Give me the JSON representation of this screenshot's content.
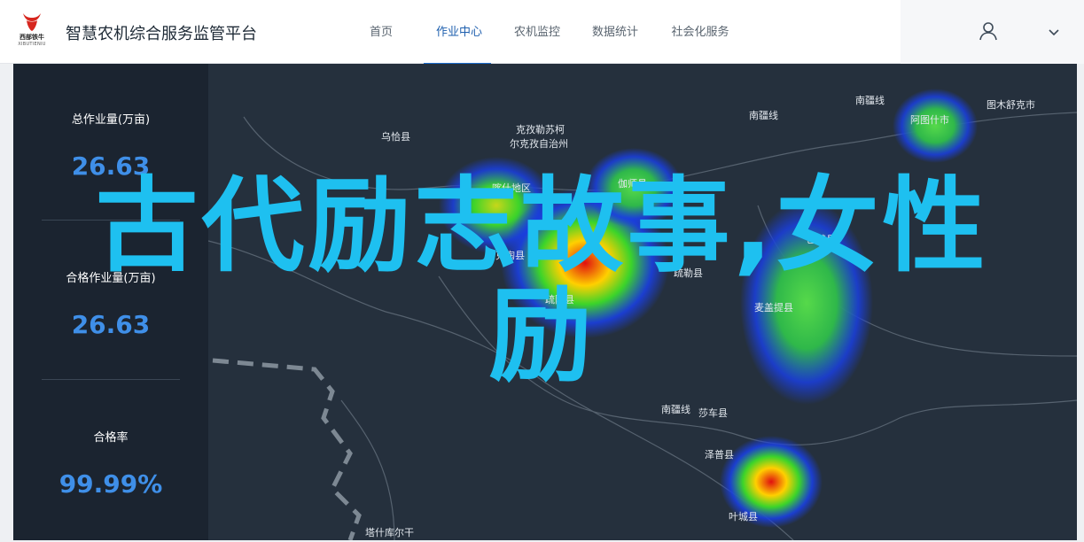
{
  "brand": {
    "logo_text": "西部铁牛",
    "logo_sub": "XIBUTIENIU",
    "title": "智慧农机综合服务监管平台"
  },
  "nav": [
    {
      "label": "首页",
      "active": false
    },
    {
      "label": "作业中心",
      "active": true
    },
    {
      "label": "农机监控",
      "active": false
    },
    {
      "label": "数据统计",
      "active": false
    },
    {
      "label": "社会化服务",
      "active": false
    }
  ],
  "stats": [
    {
      "label": "总作业量(万亩)",
      "value": "26.63"
    },
    {
      "label": "合格作业量(万亩)",
      "value": "26.63"
    },
    {
      "label": "合格率",
      "value": "99.99%"
    }
  ],
  "map_labels": [
    "乌恰县",
    "克孜勒苏柯",
    "尔克孜自治州",
    "南疆线",
    "南疆线",
    "图木舒克市",
    "阿图什市",
    "喀什地区",
    "伽师县",
    "巴楚县",
    "阿克陶县",
    "疏附县",
    "疏勒县",
    "麦盖提县",
    "南疆线",
    "莎车县",
    "泽普县",
    "叶城县",
    "塔什库尔干"
  ],
  "overlay_text": {
    "line1": "古代励志故事,女性",
    "line2": "励"
  },
  "colors": {
    "accent": "#1e6fd0",
    "stat_value": "#3f8fe8",
    "overlay": "#1ec0f0",
    "map_bg": "#25303d"
  }
}
